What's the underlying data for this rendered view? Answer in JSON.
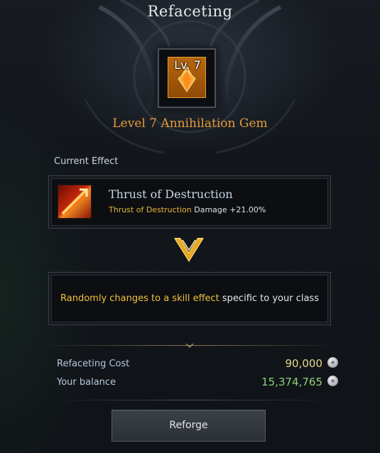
{
  "window": {
    "title": "Refaceting"
  },
  "gem": {
    "level_badge": "Lv. 7",
    "name": "Level 7 Annihilation Gem",
    "icon": "annihilation-gem-icon"
  },
  "current_effect": {
    "section_label": "Current Effect",
    "skill_name": "Thrust of Destruction",
    "effect_skill": "Thrust of Destruction",
    "effect_stat": " Damage +21.00%",
    "icon": "thrust-of-destruction-skill-icon"
  },
  "result": {
    "highlight": "Randomly changes to a skill effect",
    "rest": " specific to your class"
  },
  "cost": {
    "refaceting_label": "Refaceting Cost",
    "refaceting_value": "90,000",
    "balance_label": "Your balance",
    "balance_value": "15,374,765",
    "currency_icon": "silver-coin-icon"
  },
  "actions": {
    "reforge_label": "Reforge"
  },
  "colors": {
    "gem_name": "#e69b3a",
    "highlight": "#f0c33c",
    "cost_value": "#e8d98a",
    "balance_value": "#8fd07a"
  }
}
